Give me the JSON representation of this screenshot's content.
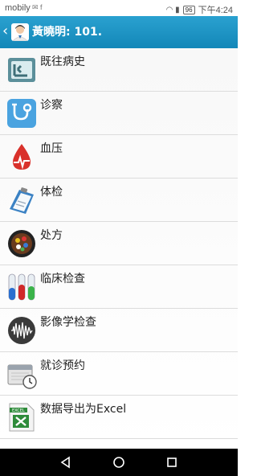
{
  "status_bar": {
    "carrier": "mobily",
    "battery": "96",
    "time": "下午4:24"
  },
  "header": {
    "back_icon": "chevron-left-icon",
    "avatar_icon": "doctor-avatar-icon",
    "title": "黃曉明: 101."
  },
  "menu": {
    "items": [
      {
        "label": "既往病史",
        "icon": "medical-history-icon"
      },
      {
        "label": "诊察",
        "icon": "stethoscope-icon"
      },
      {
        "label": "血压",
        "icon": "blood-pressure-icon"
      },
      {
        "label": "体检",
        "icon": "clipboard-icon"
      },
      {
        "label": "处方",
        "icon": "pills-icon"
      },
      {
        "label": "临床检查",
        "icon": "test-tubes-icon"
      },
      {
        "label": "影像学检查",
        "icon": "waveform-icon"
      },
      {
        "label": "就诊预约",
        "icon": "calendar-clock-icon"
      },
      {
        "label": "数据导出为Excel",
        "icon": "excel-icon"
      }
    ]
  },
  "nav_bar": {
    "buttons": [
      "back-nav-icon",
      "home-nav-icon",
      "recents-nav-icon"
    ]
  }
}
